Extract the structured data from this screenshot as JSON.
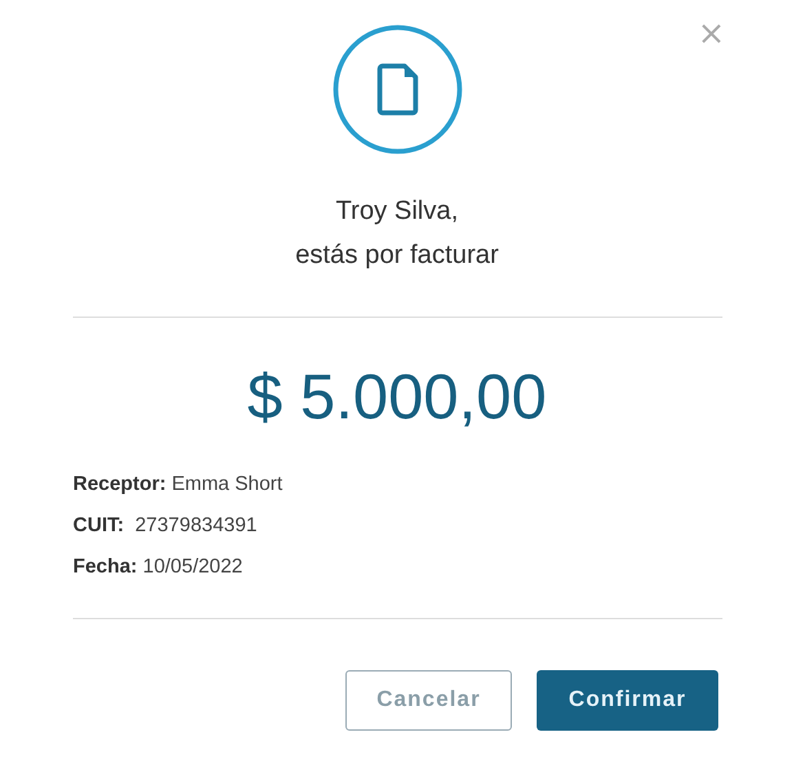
{
  "close_button": {
    "label": "×"
  },
  "title_lines": [
    "Troy Silva,",
    "estás por facturar"
  ],
  "amount": "$ 5.000,00",
  "details": [
    "**Receptor:** Emma Short",
    "**CUIT:**  27379834391",
    "**Fecha:** 10/05/2022"
  ],
  "buttons": [
    {
      "label": "Cancelar",
      "kind": "secondary"
    },
    {
      "label": "Confirmar",
      "kind": "primary"
    }
  ]
}
